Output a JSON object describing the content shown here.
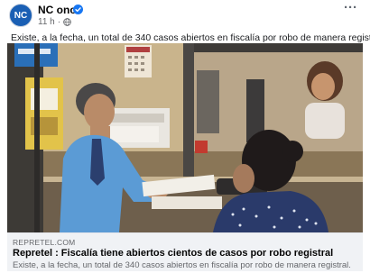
{
  "page": {
    "avatar_text": "NC",
    "name": "NC once",
    "time": "11 h",
    "separator": "·",
    "more_label": "···",
    "brand_color": "#1a5fb4",
    "verified_icon": "verified-badge-icon",
    "audience_icon": "globe-icon"
  },
  "post": {
    "text": "Existe, a la fecha, un total de 340 casos abiertos en fiscalía por robo de manera registral."
  },
  "link_preview": {
    "domain": "REPRETEL.COM",
    "title": "Repretel : Fiscalía tiene abiertos cientos de casos por robo registral",
    "description": "Existe, a la fecha, un total de 340 casos abiertos en fiscalía por robo de manera registral."
  }
}
